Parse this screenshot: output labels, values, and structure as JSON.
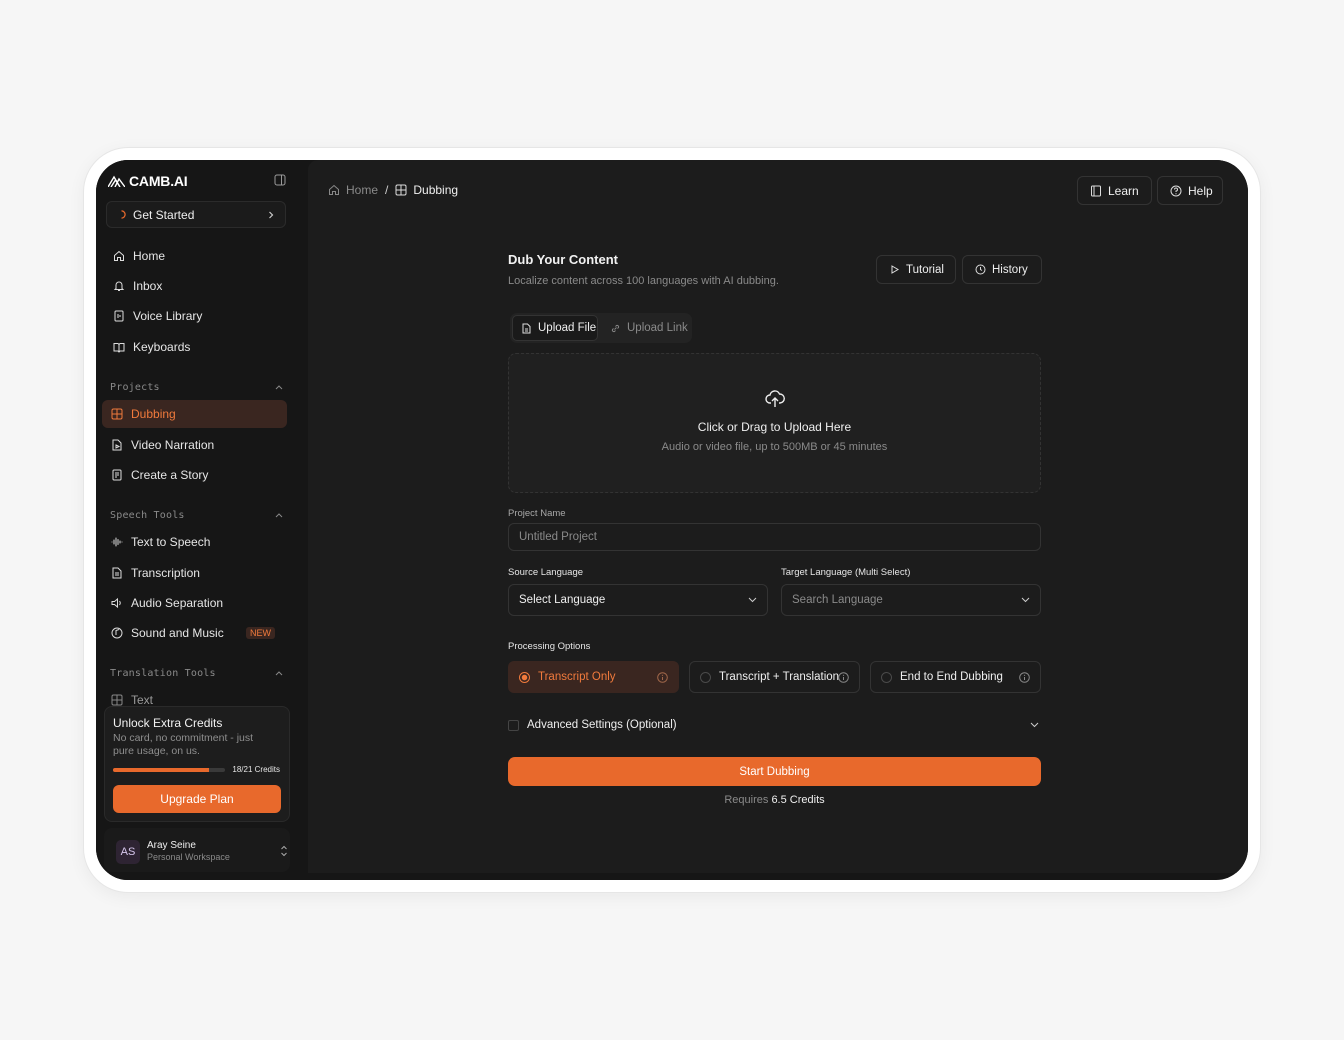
{
  "brand": {
    "name": "CAMB.AI"
  },
  "sidebar": {
    "get_started": "Get Started",
    "nav": [
      {
        "label": "Home",
        "icon": "home-icon"
      },
      {
        "label": "Inbox",
        "icon": "bell-icon"
      },
      {
        "label": "Voice Library",
        "icon": "voice-library-icon"
      },
      {
        "label": "Keyboards",
        "icon": "book-icon"
      }
    ],
    "projects_title": "Projects",
    "projects": [
      {
        "label": "Dubbing",
        "icon": "dubbing-icon",
        "active": true
      },
      {
        "label": "Video Narration",
        "icon": "video-narration-icon"
      },
      {
        "label": "Create a Story",
        "icon": "story-icon"
      }
    ],
    "speech_title": "Speech Tools",
    "speech": [
      {
        "label": "Text to Speech",
        "icon": "waveform-icon"
      },
      {
        "label": "Transcription",
        "icon": "document-icon"
      },
      {
        "label": "Audio Separation",
        "icon": "speaker-icon"
      },
      {
        "label": "Sound and Music",
        "icon": "music-icon",
        "badge": "NEW"
      }
    ],
    "translation_title": "Translation Tools",
    "translation": [
      {
        "label": "Text",
        "icon": "translate-icon"
      }
    ],
    "credits": {
      "title": "Unlock Extra Credits",
      "subtitle": "No card, no commitment - just pure usage, on us.",
      "used": 18,
      "total": 21,
      "count_label": "18/21 Credits",
      "button": "Upgrade Plan"
    },
    "user": {
      "initials": "AS",
      "name": "Aray Seine",
      "workspace": "Personal Workspace"
    }
  },
  "header": {
    "breadcrumb": {
      "home": "Home",
      "separator": "/",
      "current": "Dubbing"
    },
    "learn": "Learn",
    "help": "Help"
  },
  "main": {
    "title": "Dub Your Content",
    "subtitle": "Localize content across 100 languages with AI dubbing.",
    "tutorial": "Tutorial",
    "history": "History",
    "tabs": {
      "upload_file": "Upload File",
      "upload_link": "Upload Link"
    },
    "dropzone": {
      "title": "Click or Drag to Upload Here",
      "hint": "Audio or video file, up to 500MB or 45 minutes"
    },
    "project_name": {
      "label": "Project Name",
      "placeholder": "Untitled Project",
      "value": ""
    },
    "source_language": {
      "label": "Source Language",
      "value": "Select Language"
    },
    "target_language": {
      "label": "Target Language (Multi Select)",
      "placeholder": "Search Language"
    },
    "processing": {
      "label": "Processing Options",
      "options": [
        {
          "label": "Transcript Only",
          "selected": true
        },
        {
          "label": "Transcript + Translation",
          "selected": false
        },
        {
          "label": "End to End Dubbing",
          "selected": false
        }
      ]
    },
    "advanced": "Advanced Settings (Optional)",
    "start": "Start Dubbing",
    "requires_prefix": "Requires",
    "requires_value": "6.5 Credits"
  },
  "colors": {
    "accent": "#e8692c",
    "active_bg": "#3a2620",
    "bg": "#1c1c1c",
    "sidebar_bg": "#161616"
  }
}
